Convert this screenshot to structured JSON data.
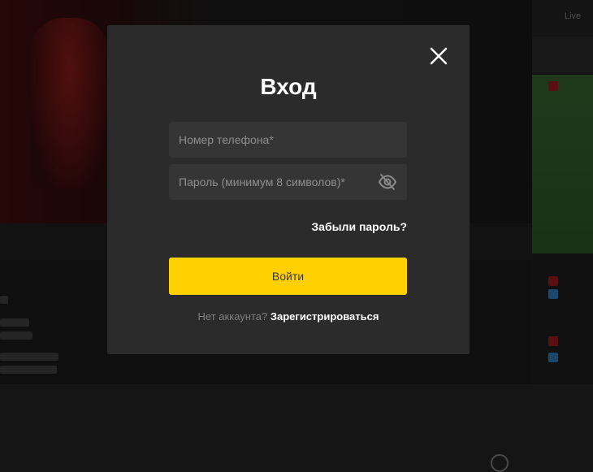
{
  "background": {
    "right_panel_label": "Live"
  },
  "modal": {
    "title": "Вход",
    "phone": {
      "placeholder": "Номер телефона*",
      "value": ""
    },
    "password": {
      "placeholder": "Пароль (минимум 8 символов)*",
      "value": ""
    },
    "forgot_label": "Забыли пароль?",
    "login_label": "Войти",
    "no_account_text": "Нет аккаунта?",
    "register_label": "Зарегистрироваться"
  },
  "colors": {
    "accent": "#ffd000",
    "modal_bg": "#2b2b2b",
    "input_bg": "#353535"
  },
  "icons": {
    "close": "close-icon",
    "password_toggle": "eye-off-icon"
  }
}
